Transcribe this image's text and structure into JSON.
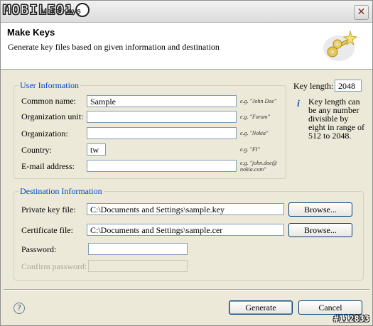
{
  "window": {
    "logo_text": "MOBILE01",
    "title": "Make Keys",
    "close_glyph": "✕"
  },
  "header": {
    "title": "Make Keys",
    "subtitle": "Generate key files based on given information and destination",
    "icon": "keys-icon"
  },
  "user_info": {
    "group_title": "User Information",
    "fields": [
      {
        "label": "Common name:",
        "value": "Sample",
        "hint": "e.g. \"John Doe\""
      },
      {
        "label": "Organization unit:",
        "value": "",
        "hint": "e.g. \"Forum\""
      },
      {
        "label": "Organization:",
        "value": "",
        "hint": "e.g. \"Nokia\""
      },
      {
        "label": "Country:",
        "value": "tw",
        "hint": "e.g. \"FI\""
      },
      {
        "label": "E-mail address:",
        "value": "",
        "hint": "e.g. \"john.doe@ nokia.com\""
      }
    ]
  },
  "key_length": {
    "label": "Key length:",
    "value": "2048",
    "info": "Key length can be any number divisible by eight in range of 512 to 2048."
  },
  "destination": {
    "group_title": "Destination Information",
    "private_key_label": "Private key file:",
    "private_key_value": "C:\\Documents and Settings\\sample.key",
    "certificate_label": "Certificate file:",
    "certificate_value": "C:\\Documents and Settings\\sample.cer",
    "browse_label": "Browse...",
    "password_label": "Password:",
    "password_value": "",
    "confirm_label": "Confirm password:",
    "confirm_value": ""
  },
  "footer": {
    "help_glyph": "?",
    "generate_label": "Generate",
    "cancel_label": "Cancel",
    "watermark": "#112833"
  },
  "colors": {
    "group_title": "#0046d5",
    "dialog_bg": "#ece9d8",
    "input_border": "#7f9db9"
  }
}
